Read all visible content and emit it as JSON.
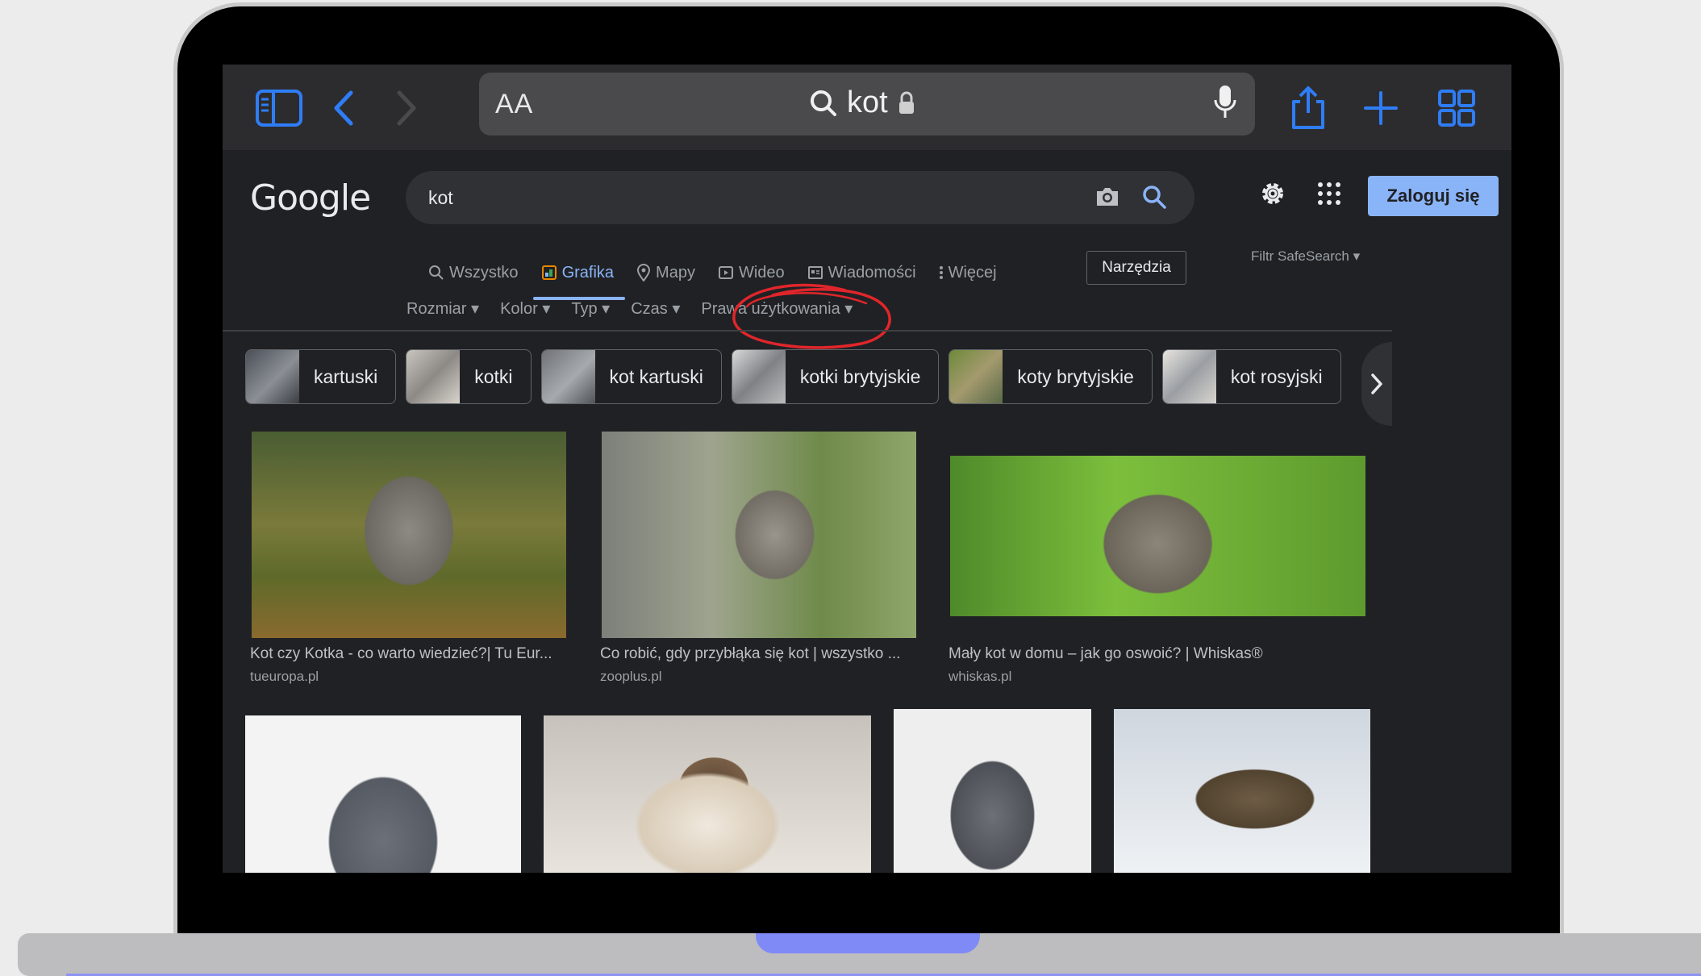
{
  "browser": {
    "aa_label": "AA",
    "url_text": "kot"
  },
  "google": {
    "logo": "Google",
    "search_value": "kot",
    "signin_label": "Zaloguj się",
    "tabs": [
      {
        "label": "Wszystko",
        "icon": "search-icon",
        "active": false
      },
      {
        "label": "Grafika",
        "icon": "image-icon",
        "active": true
      },
      {
        "label": "Mapy",
        "icon": "pin-icon",
        "active": false
      },
      {
        "label": "Wideo",
        "icon": "play-icon",
        "active": false
      },
      {
        "label": "Wiadomości",
        "icon": "news-icon",
        "active": false
      },
      {
        "label": "Więcej",
        "icon": "more-vert-icon",
        "active": false
      }
    ],
    "tools_label": "Narzędzia",
    "safesearch_label": "Filtr SafeSearch",
    "filters": [
      "Rozmiar",
      "Kolor",
      "Typ",
      "Czas",
      "Prawa użytkowania"
    ],
    "chips": [
      "kartuski",
      "kotki",
      "kot kartuski",
      "kotki brytyjskie",
      "koty brytyjskie",
      "kot rosyjski"
    ],
    "results": [
      {
        "caption": "Kot czy Kotka - co warto wiedzieć?| Tu Eur...",
        "source": "tueuropa.pl"
      },
      {
        "caption": "Co robić, gdy przybłąka się kot | wszystko ...",
        "source": "zooplus.pl"
      },
      {
        "caption": "Mały kot w domu – jak go oswoić? | Whiskas®",
        "source": "whiskas.pl"
      }
    ]
  },
  "colors": {
    "accent": "#8ab4f8",
    "page_bg": "#202124",
    "annotation": "#e0262b"
  }
}
